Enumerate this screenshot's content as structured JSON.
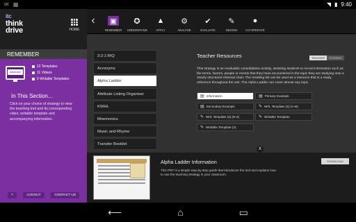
{
  "status": {
    "time": "9:40"
  },
  "logo": {
    "line1": "itc",
    "line2": "think",
    "line3": "drive"
  },
  "home": {
    "label": "HOME"
  },
  "remember": {
    "header": "REMEMBER",
    "monitor_label": "database",
    "items": [
      "12 Templates",
      "11 Videos",
      "6 Writable Templates"
    ]
  },
  "section": {
    "title": "In This Section...",
    "text": "Click on your choice of strategy to view the teaching tool and its corresponding video, writable template and accompanying information."
  },
  "sidebar_buttons": {
    "help": "?",
    "logout": "LOGOUT",
    "contact": "CONTACT US"
  },
  "nav": {
    "items": [
      {
        "label": "REMEMBER",
        "icon": "▣"
      },
      {
        "label": "UNDERSTAND",
        "icon": "✪"
      },
      {
        "label": "APPLY",
        "icon": "▲"
      },
      {
        "label": "ANALYSE",
        "icon": "⚙"
      },
      {
        "label": "EVALUATE",
        "icon": "✔"
      },
      {
        "label": "DESIGN",
        "icon": "✎"
      },
      {
        "label": "CO-OPERATE",
        "icon": "●"
      }
    ]
  },
  "strategies": [
    "3:2:1:RIQ",
    "Acronyms",
    "Alpha Ladder",
    "Attribute Listing Organiser",
    "KWHL",
    "Mnemonics",
    "Music and Rhyme",
    "Transfer Booklet"
  ],
  "selected_strategy": "Alpha Ladder",
  "resources": {
    "title": "Teacher Resources",
    "toggle": [
      "TEACHER",
      "STUDENT"
    ],
    "text": "This strategy is an invaluable consolidation activity, assisting students to record information such as the terms, factors, people or events that they have encountered in the topic they are studying onto a clearly structured retrieval chart. The resulting list can be used as a resource that is a ready reference throughout the unit. The Alpha Ladder can cover almost any topic.",
    "buttons": [
      {
        "label": "Information",
        "icon": "▤",
        "active": true
      },
      {
        "label": "Primary Example",
        "icon": "▤",
        "active": false
      },
      {
        "label": "Secondary Example",
        "icon": "▤",
        "active": false
      },
      {
        "label": "Writ. Template (3) (A-M)",
        "icon": "✎",
        "active": false
      },
      {
        "label": "Writ. Template (3) (N-Z)",
        "icon": "✎",
        "active": false
      },
      {
        "label": "Writable Template",
        "icon": "✎",
        "active": false
      },
      {
        "label": "Writable Template (4)",
        "icon": "✎",
        "active": false
      }
    ]
  },
  "info": {
    "title": "Alpha Ladder Information",
    "download": "DOWNLOAD",
    "text": "This PDF is a simple step-by-step guide that introduces the tool and explains how to use the teaching strategy in your classroom.",
    "close": "X"
  }
}
